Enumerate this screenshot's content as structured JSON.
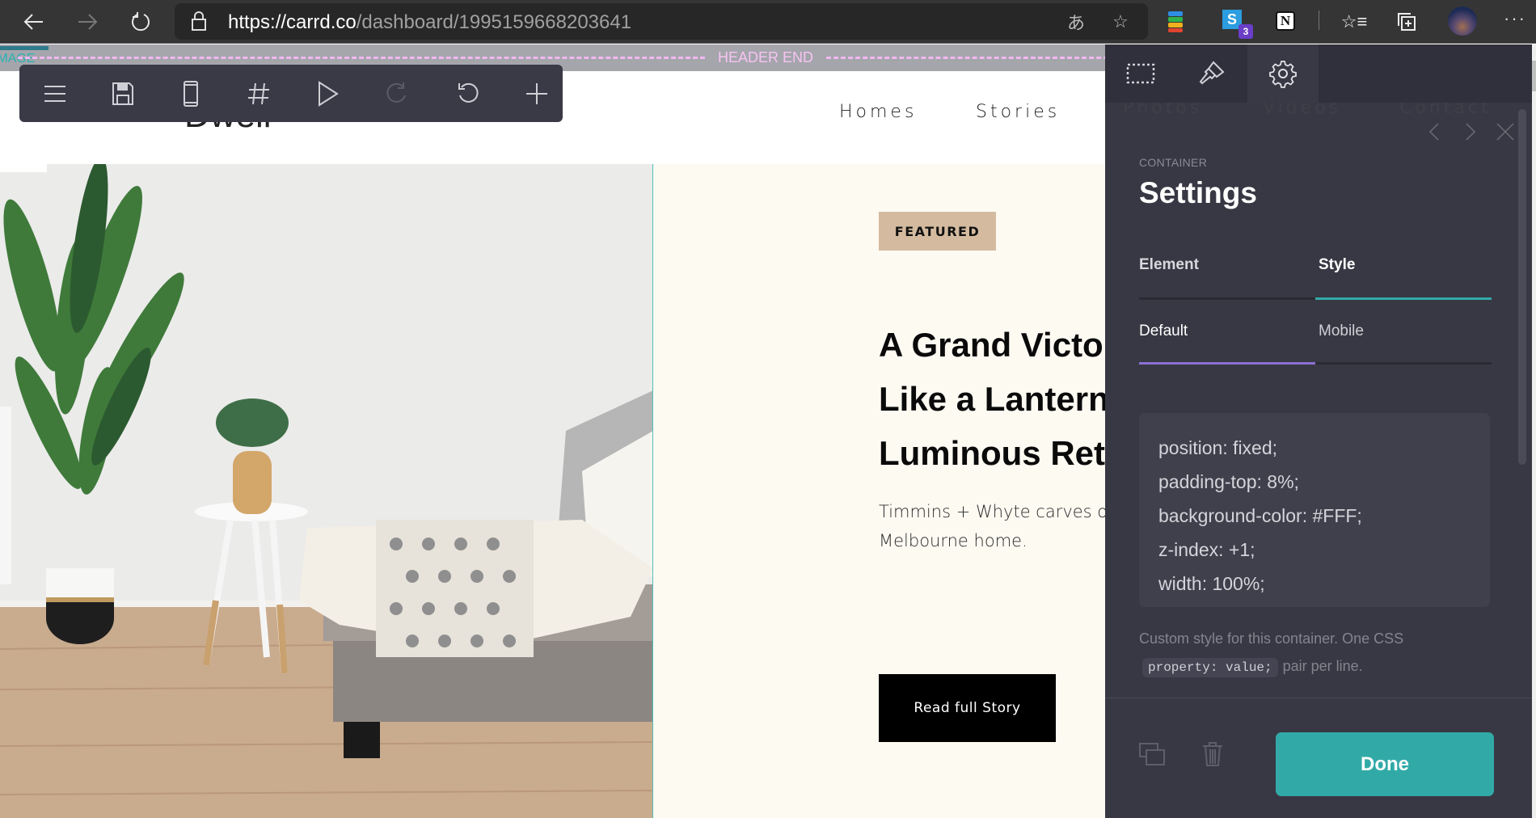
{
  "browser": {
    "url_host": "https://carrd.co",
    "url_path": "/dashboard/1995159668203641",
    "extensions": [
      {
        "name": "colorful-stack-extension"
      },
      {
        "name": "s-extension",
        "badge": "3"
      },
      {
        "name": "notion-extension"
      }
    ]
  },
  "editor_guides": {
    "header_end_label": "HEADER END",
    "image_label": "IMAGE"
  },
  "toolbar": {
    "items": [
      "menu",
      "save",
      "mobile-preview",
      "hash",
      "play",
      "redo",
      "undo",
      "add"
    ]
  },
  "site": {
    "logo": "Dwell",
    "nav": [
      "Homes",
      "Stories",
      "Photos",
      "Videos",
      "Contact"
    ],
    "featured_badge": "FEATURED",
    "headline": "A Grand Victorian Glows Like a Lantern After a Luminous Retrofit",
    "body": "Timmins + Whyte carves out a ... heritage-listed Melbourne home.",
    "body_visible": "Timmins + Whyte carves o\nMelbourne home.",
    "cta_label": "Read full Story"
  },
  "panel": {
    "tabs": [
      "select-area",
      "style-brush",
      "settings"
    ],
    "active_tab": "settings",
    "kicker": "CONTAINER",
    "title": "Settings",
    "segments": [
      {
        "label": "Element",
        "active": false
      },
      {
        "label": "Style",
        "active": true
      }
    ],
    "subsegments": [
      {
        "label": "Default",
        "active": true
      },
      {
        "label": "Mobile",
        "active": false
      }
    ],
    "css_lines": [
      "position: fixed;",
      "padding-top: 8%;",
      "background-color: #FFF;",
      "z-index: +1;",
      "width: 100%;"
    ],
    "hint_prefix": "Custom style for this container. One CSS",
    "hint_code": "property: value;",
    "hint_suffix": "pair per line.",
    "done_label": "Done"
  },
  "colors": {
    "accent_teal": "#31aaa7",
    "accent_purple": "#8b6fd6",
    "panel_bg": "#383844",
    "badge_bg": "#d4bb9f",
    "feature_bg": "#fdfaf2"
  }
}
